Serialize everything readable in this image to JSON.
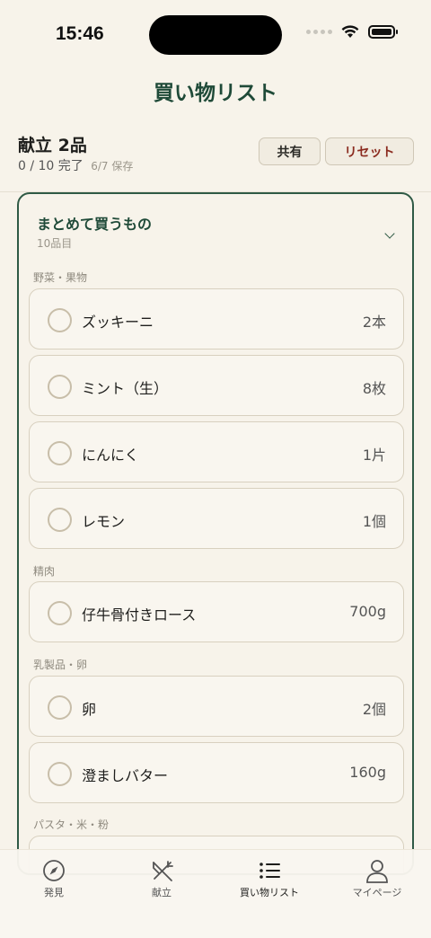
{
  "status": {
    "time": "15:46"
  },
  "nav": {
    "title": "買い物リスト"
  },
  "summary": {
    "title": "献立 2品",
    "progress": "0 / 10 完了",
    "saved": "6/7 保存",
    "share_label": "共有",
    "reset_label": "リセット"
  },
  "card": {
    "title": "まとめて買うもの",
    "subtitle": "10品目",
    "sections": [
      {
        "label": "野菜・果物",
        "items": [
          {
            "name": "ズッキーニ",
            "qty": "2本"
          },
          {
            "name": "ミント（生）",
            "qty": "8枚"
          },
          {
            "name": "にんにく",
            "qty": "1片"
          },
          {
            "name": "レモン",
            "qty": "1個"
          }
        ]
      },
      {
        "label": "精肉",
        "items": [
          {
            "name": "仔牛骨付きロース",
            "qty": "700g"
          }
        ]
      },
      {
        "label": "乳製品・卵",
        "items": [
          {
            "name": "卵",
            "qty": "2個"
          },
          {
            "name": "澄ましバター",
            "qty": "160g"
          }
        ]
      },
      {
        "label": "パスタ・米・粉",
        "items": []
      }
    ]
  },
  "tabs": [
    {
      "label": "発見",
      "icon": "compass-icon"
    },
    {
      "label": "献立",
      "icon": "fork-knife-icon"
    },
    {
      "label": "買い物リスト",
      "icon": "list-icon"
    },
    {
      "label": "マイページ",
      "icon": "person-icon"
    }
  ],
  "colors": {
    "accent": "#1f4a38",
    "reset": "#8b2b1f",
    "background": "#f7f3ea"
  }
}
